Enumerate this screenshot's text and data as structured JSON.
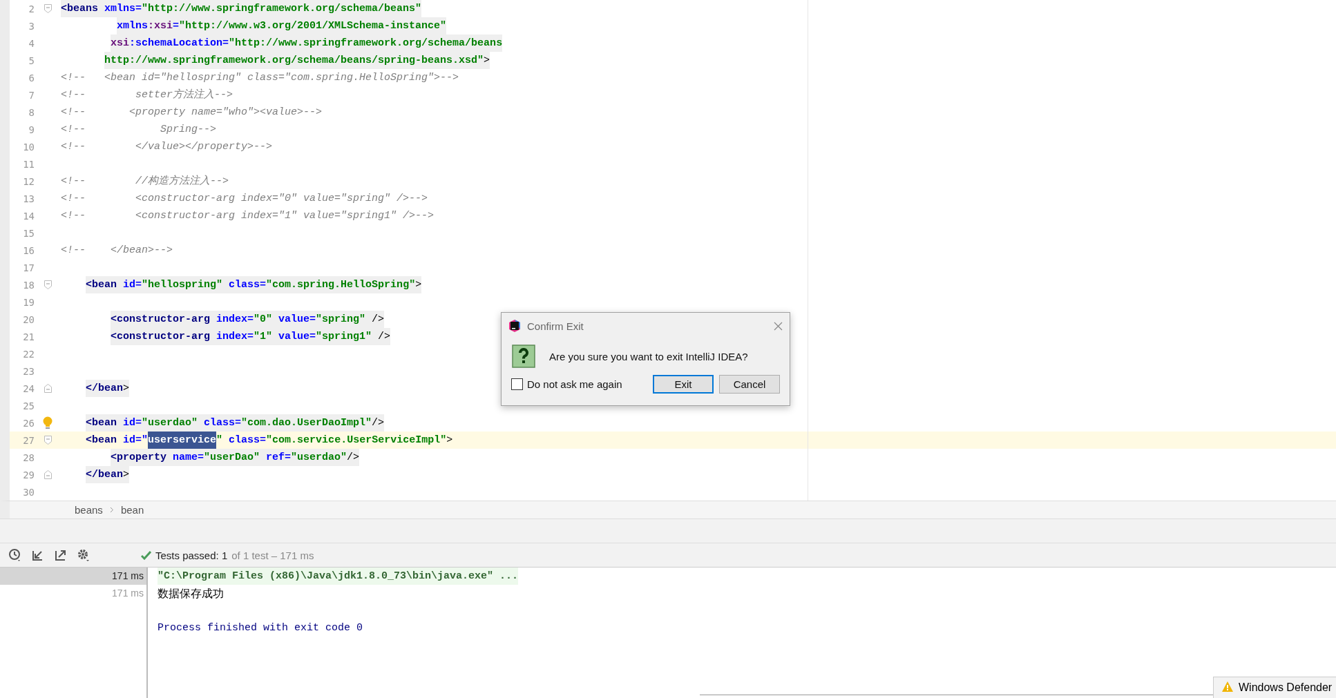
{
  "editor": {
    "lines": [
      {
        "number": "2",
        "fold_start": true,
        "fold_end": false,
        "bulb": false,
        "current": false,
        "shaded": true,
        "segments": [
          {
            "text": "<beans",
            "kind": "tag"
          },
          {
            "text": " xmlns=",
            "kind": "attr"
          },
          {
            "text": "\"http://www.springframework.org/schema/beans\"",
            "kind": "value"
          }
        ]
      },
      {
        "number": "3",
        "fold_start": false,
        "fold_end": false,
        "bulb": false,
        "current": false,
        "shaded": true,
        "segments": [
          {
            "text": "         xmlns",
            "kind": "attr"
          },
          {
            "text": ":xsi",
            "kind": "ns"
          },
          {
            "text": "=",
            "kind": "attr"
          },
          {
            "text": "\"http://www.w3.org/2001/XMLSchema-instance\"",
            "kind": "value"
          }
        ]
      },
      {
        "number": "4",
        "fold_start": false,
        "fold_end": false,
        "bulb": false,
        "current": false,
        "shaded": true,
        "segments": [
          {
            "text": "        xsi",
            "kind": "ns"
          },
          {
            "text": ":schemaLocation=",
            "kind": "attr"
          },
          {
            "text": "\"http://www.springframework.org/schema/beans",
            "kind": "value"
          }
        ]
      },
      {
        "number": "5",
        "fold_start": false,
        "fold_end": false,
        "bulb": false,
        "current": false,
        "shaded": true,
        "segments": [
          {
            "text": "       http://www.springframework.org/schema/beans/spring-beans.xsd\"",
            "kind": "value"
          },
          {
            "text": ">",
            "kind": "plain"
          }
        ]
      },
      {
        "number": "6",
        "fold_start": false,
        "fold_end": false,
        "bulb": false,
        "current": false,
        "shaded": false,
        "segments": [
          {
            "text": "<!--   <bean id=\"hellospring\" class=\"com.spring.HelloSpring\">-->",
            "kind": "comment"
          }
        ]
      },
      {
        "number": "7",
        "fold_start": false,
        "fold_end": false,
        "bulb": false,
        "current": false,
        "shaded": false,
        "segments": [
          {
            "text": "<!--        setter方法注入-->",
            "kind": "comment"
          }
        ]
      },
      {
        "number": "8",
        "fold_start": false,
        "fold_end": false,
        "bulb": false,
        "current": false,
        "shaded": false,
        "segments": [
          {
            "text": "<!--       <property name=\"who\"><value>-->",
            "kind": "comment"
          }
        ]
      },
      {
        "number": "9",
        "fold_start": false,
        "fold_end": false,
        "bulb": false,
        "current": false,
        "shaded": false,
        "segments": [
          {
            "text": "<!--            Spring-->",
            "kind": "comment"
          }
        ]
      },
      {
        "number": "10",
        "fold_start": false,
        "fold_end": false,
        "bulb": false,
        "current": false,
        "shaded": false,
        "segments": [
          {
            "text": "<!--        </value></property>-->",
            "kind": "comment"
          }
        ]
      },
      {
        "number": "11",
        "fold_start": false,
        "fold_end": false,
        "bulb": false,
        "current": false
      },
      {
        "number": "12",
        "fold_start": false,
        "fold_end": false,
        "bulb": false,
        "current": false,
        "shaded": false,
        "segments": [
          {
            "text": "<!--        //构造方法注入-->",
            "kind": "comment"
          }
        ]
      },
      {
        "number": "13",
        "fold_start": false,
        "fold_end": false,
        "bulb": false,
        "current": false,
        "shaded": false,
        "segments": [
          {
            "text": "<!--        <constructor-arg index=\"0\" value=\"spring\" />-->",
            "kind": "comment"
          }
        ]
      },
      {
        "number": "14",
        "fold_start": false,
        "fold_end": false,
        "bulb": false,
        "current": false,
        "shaded": false,
        "segments": [
          {
            "text": "<!--        <constructor-arg index=\"1\" value=\"spring1\" />-->",
            "kind": "comment"
          }
        ]
      },
      {
        "number": "15",
        "fold_start": false,
        "fold_end": false,
        "bulb": false,
        "current": false
      },
      {
        "number": "16",
        "fold_start": false,
        "fold_end": false,
        "bulb": false,
        "current": false,
        "shaded": false,
        "segments": [
          {
            "text": "<!--    </bean>-->",
            "kind": "comment"
          }
        ]
      },
      {
        "number": "17",
        "fold_start": false,
        "fold_end": false,
        "bulb": false,
        "current": false
      },
      {
        "number": "18",
        "fold_start": true,
        "fold_end": false,
        "bulb": false,
        "current": false,
        "shaded": true,
        "segments": [
          {
            "text": "    <bean",
            "kind": "tag"
          },
          {
            "text": " id=",
            "kind": "attr"
          },
          {
            "text": "\"hellospring\"",
            "kind": "value"
          },
          {
            "text": " class=",
            "kind": "attr"
          },
          {
            "text": "\"com.spring.HelloSpring\"",
            "kind": "value"
          },
          {
            "text": ">",
            "kind": "plain"
          }
        ]
      },
      {
        "number": "19",
        "fold_start": false,
        "fold_end": false,
        "bulb": false,
        "current": false
      },
      {
        "number": "20",
        "fold_start": false,
        "fold_end": false,
        "bulb": false,
        "current": false,
        "shaded": true,
        "segments": [
          {
            "text": "        <constructor-arg",
            "kind": "tag"
          },
          {
            "text": " index=",
            "kind": "attr"
          },
          {
            "text": "\"0\"",
            "kind": "value"
          },
          {
            "text": " value=",
            "kind": "attr"
          },
          {
            "text": "\"spring\"",
            "kind": "value"
          },
          {
            "text": " />",
            "kind": "plain"
          }
        ]
      },
      {
        "number": "21",
        "fold_start": false,
        "fold_end": false,
        "bulb": false,
        "current": false,
        "shaded": true,
        "segments": [
          {
            "text": "        <constructor-arg",
            "kind": "tag"
          },
          {
            "text": " index=",
            "kind": "attr"
          },
          {
            "text": "\"1\"",
            "kind": "value"
          },
          {
            "text": " value=",
            "kind": "attr"
          },
          {
            "text": "\"spring1\"",
            "kind": "value"
          },
          {
            "text": " />",
            "kind": "plain"
          }
        ]
      },
      {
        "number": "22",
        "fold_start": false,
        "fold_end": false,
        "bulb": false,
        "current": false
      },
      {
        "number": "23",
        "fold_start": false,
        "fold_end": false,
        "bulb": false,
        "current": false
      },
      {
        "number": "24",
        "fold_start": false,
        "fold_end": true,
        "bulb": false,
        "current": false,
        "shaded": true,
        "segments": [
          {
            "text": "    </bean",
            "kind": "tag"
          },
          {
            "text": ">",
            "kind": "plain"
          }
        ]
      },
      {
        "number": "25",
        "fold_start": false,
        "fold_end": false,
        "bulb": false,
        "current": false
      },
      {
        "number": "26",
        "fold_start": false,
        "fold_end": false,
        "bulb": true,
        "current": false,
        "shaded": true,
        "segments": [
          {
            "text": "    <bean",
            "kind": "tag"
          },
          {
            "text": " id=",
            "kind": "attr"
          },
          {
            "text": "\"userdao\"",
            "kind": "value"
          },
          {
            "text": " class=",
            "kind": "attr"
          },
          {
            "text": "\"com.dao.UserDaoImpl\"",
            "kind": "value"
          },
          {
            "text": "/>",
            "kind": "plain"
          }
        ]
      },
      {
        "number": "27",
        "fold_start": true,
        "fold_end": false,
        "bulb": false,
        "current": true,
        "shaded": false,
        "segments": [
          {
            "text": "    <bean",
            "kind": "tag"
          },
          {
            "text": " id=\"",
            "kind": "attr"
          },
          {
            "text": "userservice",
            "kind": "selection"
          },
          {
            "text": "\"",
            "kind": "value"
          },
          {
            "text": " class=",
            "kind": "attr"
          },
          {
            "text": "\"com.service.UserServiceImpl\"",
            "kind": "value"
          },
          {
            "text": ">",
            "kind": "plain"
          }
        ]
      },
      {
        "number": "28",
        "fold_start": false,
        "fold_end": false,
        "bulb": false,
        "current": false,
        "shaded": true,
        "segments": [
          {
            "text": "        <property",
            "kind": "tag"
          },
          {
            "text": " name=",
            "kind": "attr"
          },
          {
            "text": "\"userDao\"",
            "kind": "value"
          },
          {
            "text": " ref=",
            "kind": "attr"
          },
          {
            "text": "\"userdao\"",
            "kind": "value"
          },
          {
            "text": "/>",
            "kind": "plain"
          }
        ]
      },
      {
        "number": "29",
        "fold_start": false,
        "fold_end": true,
        "bulb": false,
        "current": false,
        "shaded": true,
        "segments": [
          {
            "text": "    </bean",
            "kind": "tag"
          },
          {
            "text": ">",
            "kind": "plain"
          }
        ]
      },
      {
        "number": "30",
        "fold_start": false,
        "fold_end": false,
        "bulb": false,
        "current": false
      }
    ]
  },
  "breadcrumbs": [
    "beans",
    "bean"
  ],
  "test_toolbar": {
    "status": "Tests passed: 1",
    "detail": "of 1 test – 171 ms"
  },
  "test_tree": [
    {
      "label": "171 ms",
      "selected": true
    },
    {
      "label": "171 ms",
      "selected": false
    }
  ],
  "console": [
    {
      "text": "\"C:\\Program Files (x86)\\Java\\jdk1.8.0_73\\bin\\java.exe\" ...",
      "kind": "command"
    },
    {
      "text": "数据保存成功",
      "kind": "output"
    },
    {
      "kind": "blank"
    },
    {
      "text": "Process finished with exit code 0",
      "kind": "system"
    }
  ],
  "dialog": {
    "title": "Confirm Exit",
    "message": "Are you sure you want to exit IntelliJ IDEA?",
    "checkbox": {
      "label": "Do not ask me again",
      "checked": false
    },
    "buttons": [
      {
        "label": "Exit",
        "default": true
      },
      {
        "label": "Cancel",
        "default": false
      }
    ]
  },
  "notification": {
    "title": "Windows Defender"
  }
}
